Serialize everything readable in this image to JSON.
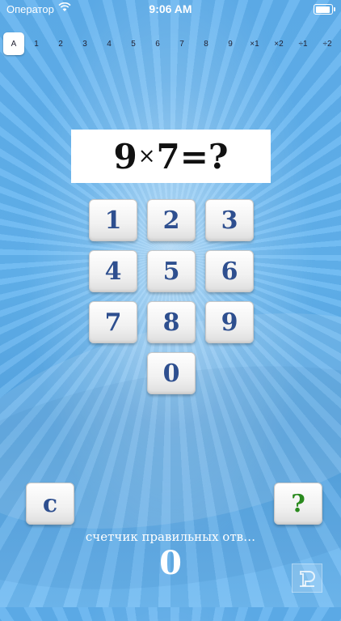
{
  "status_bar": {
    "carrier": "Оператор",
    "time": "9:06 AM",
    "wifi_icon": "wifi-icon",
    "battery_icon": "battery-icon"
  },
  "tabs": [
    "A",
    "1",
    "2",
    "3",
    "4",
    "5",
    "6",
    "7",
    "8",
    "9",
    "×1",
    "×2",
    "÷1",
    "÷2"
  ],
  "question": {
    "left": "9",
    "operator": "×",
    "right": "7",
    "equals": "=",
    "unknown": "?"
  },
  "keypad": {
    "k1": "1",
    "k2": "2",
    "k3": "3",
    "k4": "4",
    "k5": "5",
    "k6": "6",
    "k7": "7",
    "k8": "8",
    "k9": "9",
    "k0": "0"
  },
  "controls": {
    "clear_label": "c",
    "help_label": "?"
  },
  "counter": {
    "label": "счетчик правильных отв…",
    "value": "0"
  },
  "colors": {
    "key_text": "#2e4f8f",
    "help_text": "#2a8a1e",
    "background": "#5fb0ee"
  }
}
